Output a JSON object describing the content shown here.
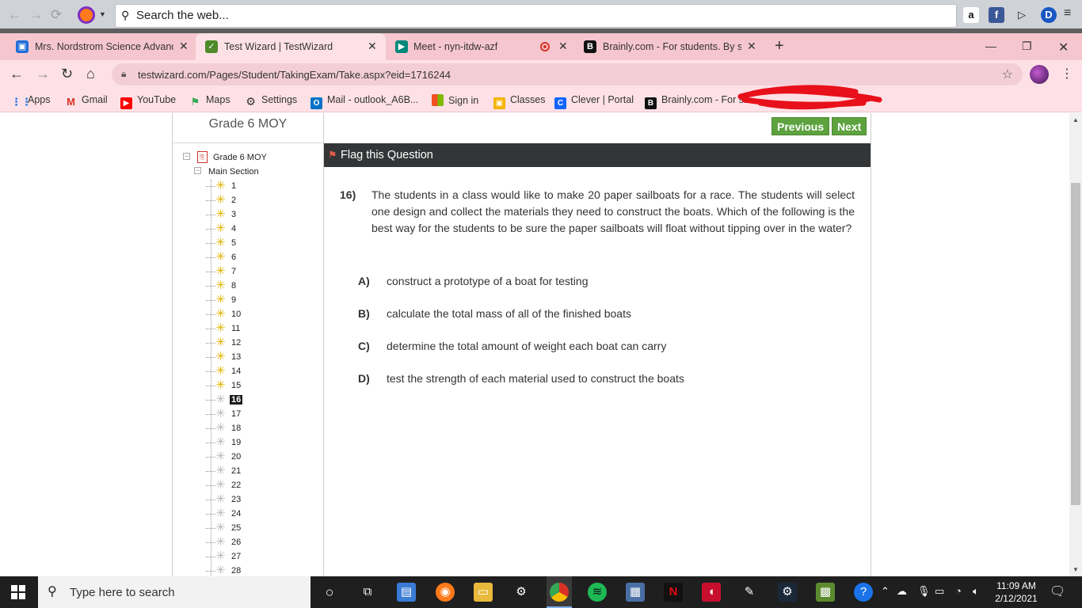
{
  "firefox_bar": {
    "search_placeholder": "Search the web...",
    "extensions": [
      {
        "icon": "amazon-icon",
        "glyph": "a"
      },
      {
        "icon": "facebook-icon",
        "glyph": "f"
      },
      {
        "icon": "play-icon",
        "glyph": "▷"
      },
      {
        "icon": "profile-d-icon",
        "glyph": "D"
      }
    ]
  },
  "tabs": [
    {
      "label": "Mrs. Nordstrom Science Advance",
      "icon": "classroom-icon",
      "color": "#1e6fd9",
      "active": false
    },
    {
      "label": "Test Wizard | TestWizard",
      "icon": "testwizard-icon",
      "color": "#4e8a2a",
      "active": true
    },
    {
      "label": "Meet - nyn-itdw-azf",
      "icon": "meet-icon",
      "color": "#00897b",
      "active": false
    },
    {
      "label": "Brainly.com - For students. By stu",
      "icon": "brainly-icon",
      "color": "#111111",
      "active": false
    }
  ],
  "address_bar": {
    "url": "testwizard.com/Pages/Student/TakingExam/Take.aspx?eid=1716244"
  },
  "bookmarks": [
    {
      "label": "Apps",
      "icon": "apps-grid-icon",
      "color": "#1a73e8"
    },
    {
      "label": "Gmail",
      "icon": "gmail-icon",
      "color": "#d93025"
    },
    {
      "label": "YouTube",
      "icon": "youtube-icon",
      "color": "#ff0000"
    },
    {
      "label": "Maps",
      "icon": "maps-icon",
      "color": "#34a853"
    },
    {
      "label": "Settings",
      "icon": "gear-icon",
      "color": "#333333"
    },
    {
      "label": "Mail - outlook_A6B...",
      "icon": "outlook-icon",
      "color": "#0072c6"
    },
    {
      "label": "Sign in",
      "icon": "microsoft-icon",
      "color": "#f25022"
    },
    {
      "label": "Classes",
      "icon": "classroom-icon",
      "color": "#f4b400"
    },
    {
      "label": "Clever | Portal",
      "icon": "clever-icon",
      "color": "#1464ff"
    },
    {
      "label": "Brainly.com - For st...",
      "icon": "brainly-icon",
      "color": "#111111"
    }
  ],
  "sidebar": {
    "title": "Grade 6 MOY",
    "root_label": "Grade 6 MOY",
    "section_label": "Main Section",
    "questions": [
      "1",
      "2",
      "3",
      "4",
      "5",
      "6",
      "7",
      "8",
      "9",
      "10",
      "11",
      "12",
      "13",
      "14",
      "15",
      "16",
      "17",
      "18",
      "19",
      "20",
      "21",
      "22",
      "23",
      "24",
      "25",
      "26",
      "27",
      "28"
    ],
    "answered_through": 15,
    "current": "16"
  },
  "main": {
    "previous_label": "Previous",
    "next_label": "Next",
    "flag_label": "Flag this Question",
    "question_number": "16)",
    "question_text": "The students in a class would like to make 20 paper sailboats for a race. The students will select one design and collect the materials they need to construct the boats. Which of the following is the best way for the students to be sure the paper sailboats will float without tipping over in the water?",
    "choices": [
      {
        "letter": "A)",
        "text": "construct a prototype of a boat for testing"
      },
      {
        "letter": "B)",
        "text": "calculate the total mass of all of the finished boats"
      },
      {
        "letter": "C)",
        "text": "determine the total amount of weight each boat can carry"
      },
      {
        "letter": "D)",
        "text": "test the strength of each material used to construct the boats"
      }
    ]
  },
  "taskbar": {
    "search_placeholder": "Type here to search",
    "time": "11:09 AM",
    "date": "2/12/2021"
  }
}
